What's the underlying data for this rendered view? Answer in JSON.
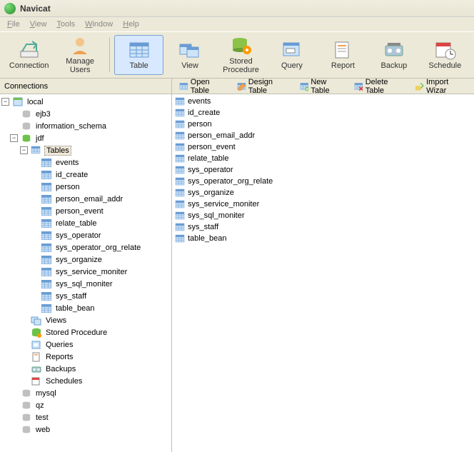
{
  "window": {
    "title": "Navicat"
  },
  "menus": {
    "file": "File",
    "view": "View",
    "tools": "Tools",
    "window": "Window",
    "help": "Help"
  },
  "toolbar": {
    "connection": "Connection",
    "manage_users": "Manage Users",
    "table": "Table",
    "view": "View",
    "stored_procedure": "Stored Procedure",
    "query": "Query",
    "report": "Report",
    "backup": "Backup",
    "schedule": "Schedule"
  },
  "left_panel": {
    "header": "Connections"
  },
  "tree": {
    "root": "local",
    "databases": {
      "ejb3": "ejb3",
      "information_schema": "information_schema",
      "jdf": {
        "label": "jdf",
        "tables_label": "Tables",
        "tables": [
          "events",
          "id_create",
          "person",
          "person_email_addr",
          "person_event",
          "relate_table",
          "sys_operator",
          "sys_operator_org_relate",
          "sys_organize",
          "sys_service_moniter",
          "sys_sql_moniter",
          "sys_staff",
          "table_bean"
        ],
        "views": "Views",
        "stored_procedure": "Stored Procedure",
        "queries": "Queries",
        "reports": "Reports",
        "backups": "Backups",
        "schedules": "Schedules"
      },
      "mysql": "mysql",
      "qz": "qz",
      "test": "test",
      "web": "web"
    }
  },
  "sub_toolbar": {
    "open_table": "Open Table",
    "design_table": "Design Table",
    "new_table": "New Table",
    "delete_table": "Delete Table",
    "import_wizard": "Import Wizar"
  },
  "table_list": [
    "events",
    "id_create",
    "person",
    "person_email_addr",
    "person_event",
    "relate_table",
    "sys_operator",
    "sys_operator_org_relate",
    "sys_organize",
    "sys_service_moniter",
    "sys_sql_moniter",
    "sys_staff",
    "table_bean"
  ]
}
